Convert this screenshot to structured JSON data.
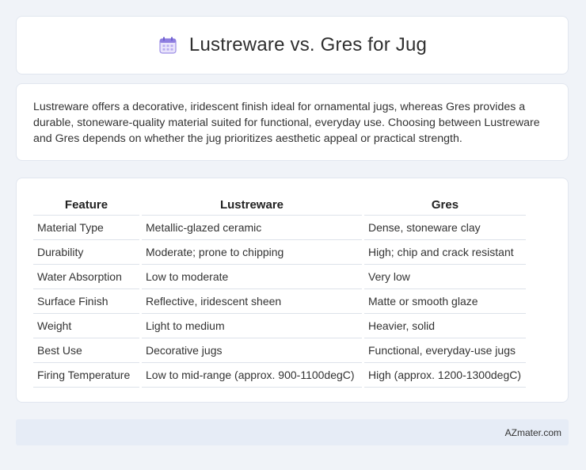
{
  "header": {
    "title": "Lustreware vs. Gres for Jug",
    "icon": "calendar-icon"
  },
  "summary": {
    "text": "Lustreware offers a decorative, iridescent finish ideal for ornamental jugs, whereas Gres provides a durable, stoneware-quality material suited for functional, everyday use. Choosing between Lustreware and Gres depends on whether the jug prioritizes aesthetic appeal or practical strength."
  },
  "table": {
    "headers": [
      "Feature",
      "Lustreware",
      "Gres"
    ],
    "rows": [
      [
        "Material Type",
        "Metallic-glazed ceramic",
        "Dense, stoneware clay"
      ],
      [
        "Durability",
        "Moderate; prone to chipping",
        "High; chip and crack resistant"
      ],
      [
        "Water Absorption",
        "Low to moderate",
        "Very low"
      ],
      [
        "Surface Finish",
        "Reflective, iridescent sheen",
        "Matte or smooth glaze"
      ],
      [
        "Weight",
        "Light to medium",
        "Heavier, solid"
      ],
      [
        "Best Use",
        "Decorative jugs",
        "Functional, everyday-use jugs"
      ],
      [
        "Firing Temperature",
        "Low to mid-range (approx. 900-1100degC)",
        "High (approx. 1200-1300degC)"
      ]
    ]
  },
  "footer": {
    "brand": "AZmater.com"
  }
}
